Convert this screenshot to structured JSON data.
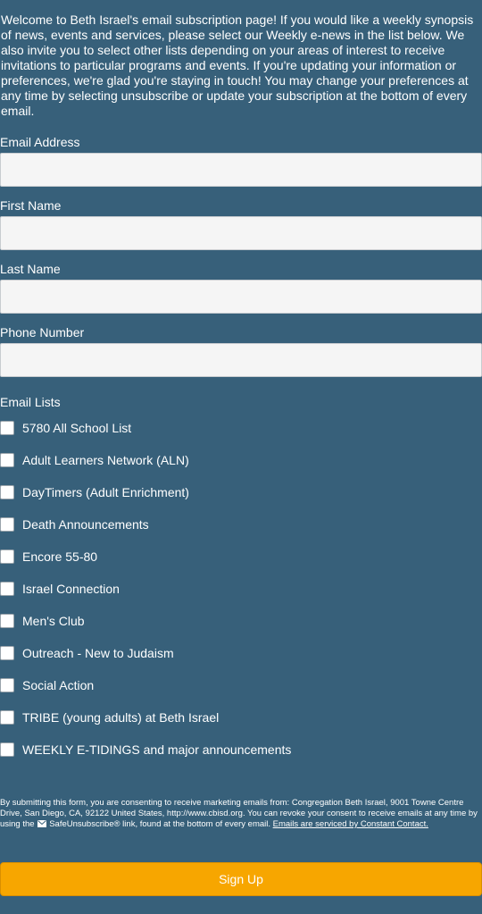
{
  "intro": "Welcome to Beth Israel's email subscription page! If you would like a weekly synopsis of news, events and services, please select our Weekly e-news in the list below. We also invite you to select other lists depending on your areas of interest to receive invitations to particular programs and events. If you're updating your information or preferences, we're glad you're staying in touch! You may change your preferences at any time by selecting unsubscribe or update your subscription at the bottom of every email.",
  "fields": {
    "email": {
      "label": "Email Address",
      "value": ""
    },
    "first_name": {
      "label": "First Name",
      "value": ""
    },
    "last_name": {
      "label": "Last Name",
      "value": ""
    },
    "phone": {
      "label": "Phone Number",
      "value": ""
    }
  },
  "email_lists": {
    "label": "Email Lists",
    "items": [
      {
        "label": "5780 All School List",
        "checked": false
      },
      {
        "label": "Adult Learners Network (ALN)",
        "checked": false
      },
      {
        "label": "DayTimers (Adult Enrichment)",
        "checked": false
      },
      {
        "label": "Death Announcements",
        "checked": false
      },
      {
        "label": "Encore 55-80",
        "checked": false
      },
      {
        "label": "Israel Connection",
        "checked": false
      },
      {
        "label": "Men's Club",
        "checked": false
      },
      {
        "label": "Outreach - New to Judaism",
        "checked": false
      },
      {
        "label": "Social Action",
        "checked": false
      },
      {
        "label": "TRIBE (young adults) at Beth Israel",
        "checked": false
      },
      {
        "label": "WEEKLY E-TIDINGS and major announcements",
        "checked": false
      }
    ]
  },
  "consent": {
    "text_before": "By submitting this form, you are consenting to receive marketing emails from: Congregation Beth Israel, 9001 Towne Centre Drive, San Diego, CA, 92122 United States, http://www.cbisd.org. You can revoke your consent to receive emails at any time by using the",
    "safeunsubscribe": "SafeUnsubscribe® link, found at the bottom of every email.",
    "link_text": "Emails are serviced by Constant Contact.",
    "icon": "envelope-icon"
  },
  "submit_label": "Sign Up",
  "colors": {
    "background": "#37607a",
    "button": "#f7a600",
    "text": "#ffffff",
    "input_bg": "#f5f5f5"
  }
}
